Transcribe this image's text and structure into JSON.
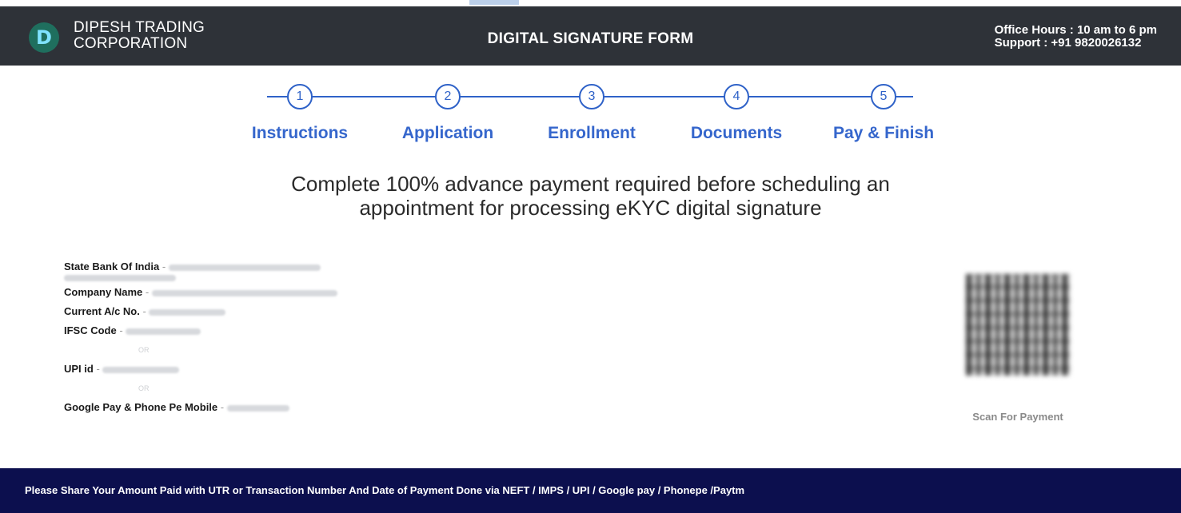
{
  "header": {
    "brand_line1": "DIPESH TRADING",
    "brand_line2": "CORPORATION",
    "title": "DIGITAL SIGNATURE FORM",
    "office_hours": "Office Hours : 10 am to 6 pm",
    "support": "Support : +91 9820026132"
  },
  "steps": [
    {
      "num": "1",
      "label": "Instructions"
    },
    {
      "num": "2",
      "label": "Application"
    },
    {
      "num": "3",
      "label": "Enrollment"
    },
    {
      "num": "4",
      "label": "Documents"
    },
    {
      "num": "5",
      "label": "Pay & Finish"
    }
  ],
  "headline": {
    "line1": "Complete 100% advance payment required before scheduling an",
    "line2": "appointment for processing eKYC digital signature"
  },
  "bank": {
    "bank_label": "State Bank Of India",
    "company_label": "Company Name",
    "account_label": "Current A/c No.",
    "ifsc_label": "IFSC Code",
    "or1": "OR",
    "upi_label": "UPI id",
    "or2": "OR",
    "gpay_label": "Google Pay & Phone Pe Mobile",
    "separator": " - "
  },
  "qr": {
    "label": "Scan For Payment"
  },
  "footer": {
    "text": "Please Share Your Amount Paid with UTR or Transaction Number And Date of Payment Done via NEFT / IMPS / UPI / Google pay / Phonepe /Paytm"
  },
  "colors": {
    "header_bg": "#2e3238",
    "step_blue": "#3566cc",
    "footer_bg": "#0c0f4e"
  }
}
